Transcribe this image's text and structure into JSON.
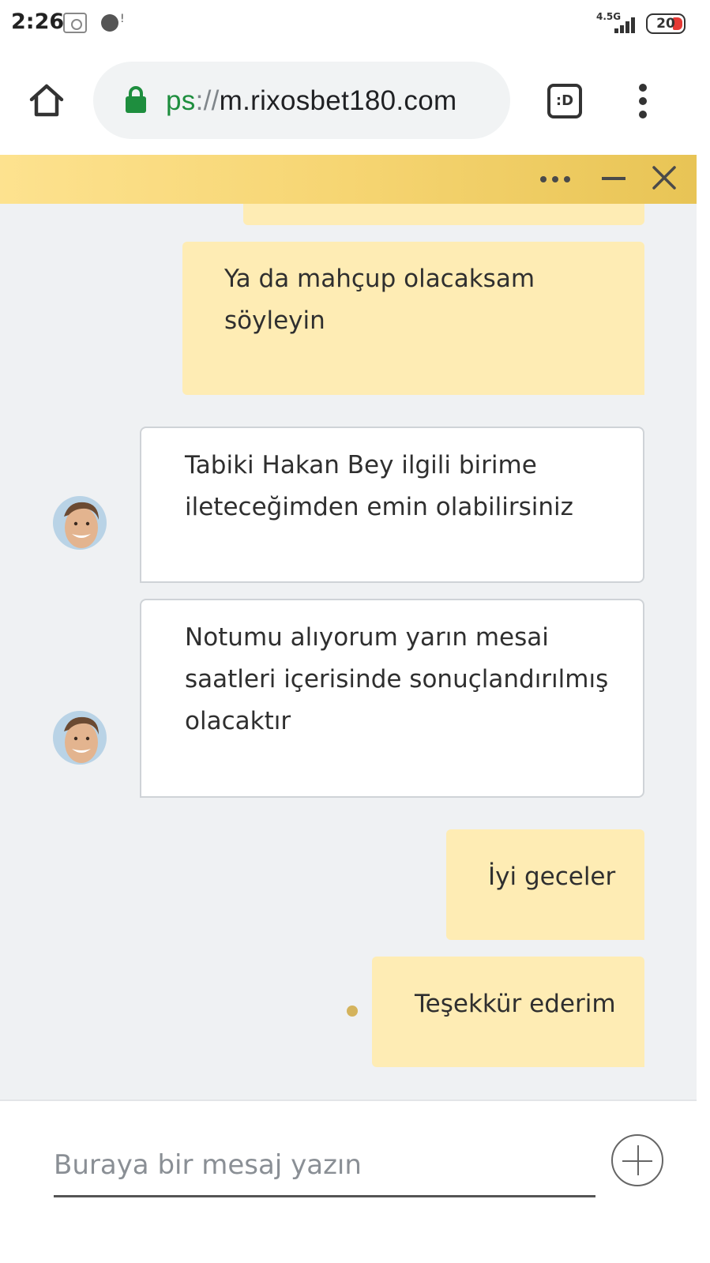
{
  "status_bar": {
    "time": "2:26",
    "network": "4.5G",
    "battery": "20"
  },
  "browser": {
    "url_scheme": "ps",
    "url_sep": "://",
    "url_host": "m.rixosbet180.com",
    "tabs_label": ":D"
  },
  "chat": {
    "messages": [
      {
        "from": "user",
        "lines": [
          "Ya da mahçup olacaksam",
          "söyleyin"
        ]
      },
      {
        "from": "agent",
        "lines": [
          "Tabiki Hakan Bey ilgili birime",
          "ileteceğimden emin olabilirsiniz"
        ]
      },
      {
        "from": "agent",
        "lines": [
          "Notumu alıyorum yarın mesai",
          "saatleri içerisinde sonuçlandırılmış",
          "olacaktır"
        ]
      },
      {
        "from": "user",
        "lines": [
          "İyi geceler"
        ]
      },
      {
        "from": "user",
        "lines": [
          "Teşekkür ederim"
        ]
      }
    ]
  },
  "composer": {
    "placeholder": "Buraya bir mesaj yazın"
  },
  "colors": {
    "header_gradient_start": "#fde28f",
    "header_gradient_end": "#e8c455",
    "user_bubble": "#feecb4",
    "agent_bubble": "#ffffff",
    "chat_background": "#eff1f3",
    "secure_green": "#1e8e3e"
  },
  "icons": [
    "home-icon",
    "lock-icon",
    "tabs-icon",
    "more-vert-icon",
    "more-horiz-icon",
    "minimize-icon",
    "close-icon",
    "add-icon"
  ]
}
